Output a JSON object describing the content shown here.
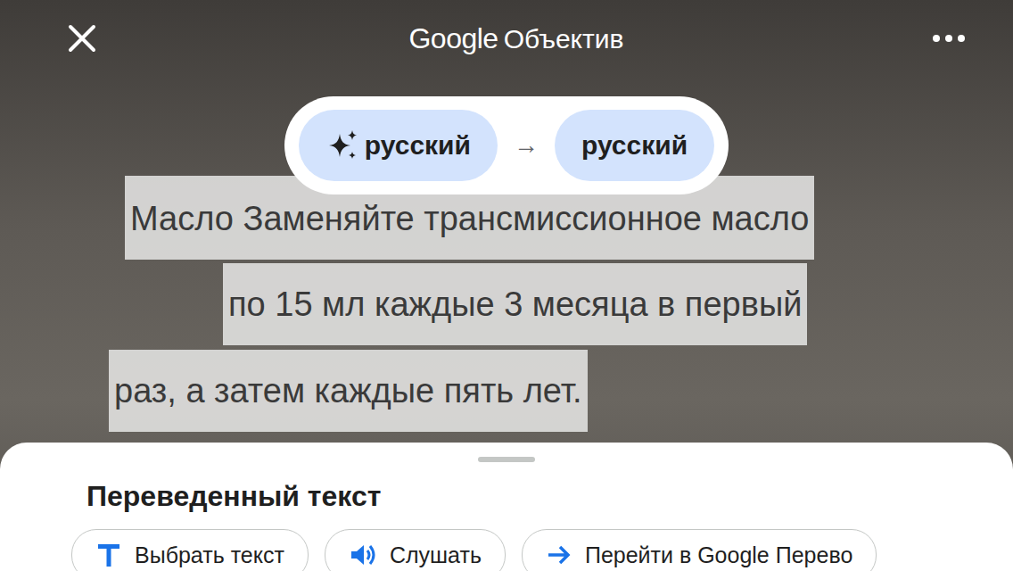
{
  "header": {
    "brand": "Google",
    "title": "Объектив"
  },
  "language": {
    "source": "русский",
    "arrow": "→",
    "target": "русский"
  },
  "translated_lines": [
    "Масло Заменяйте трансмиссионное масло",
    "по 15 мл каждые 3 месяца в первый",
    "раз, а затем каждые пять лет."
  ],
  "sheet": {
    "title": "Переведенный текст",
    "actions": [
      {
        "label": "Выбрать текст",
        "kind": "select-text"
      },
      {
        "label": "Слушать",
        "kind": "listen"
      },
      {
        "label": "Перейти в Google Перево",
        "kind": "translate"
      }
    ]
  }
}
